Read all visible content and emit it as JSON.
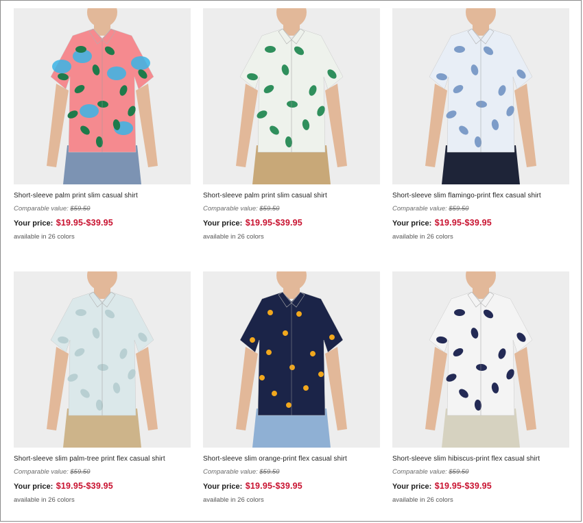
{
  "products": [
    {
      "name": "Short-sleeve palm print slim casual shirt",
      "comparable_label": "Comparable value:",
      "comparable_value": "$59.50",
      "price_label": "Your price:",
      "price": "$19.95-$39.95",
      "colors_text": "available in 26 colors",
      "shirt_color": "#f58a8f",
      "accent_color": "#39b4e6",
      "leaf_color": "#1f7a4a",
      "pants_color": "#7c93b3"
    },
    {
      "name": "Short-sleeve palm print slim casual shirt",
      "comparable_label": "Comparable value:",
      "comparable_value": "$59.50",
      "price_label": "Your price:",
      "price": "$19.95-$39.95",
      "colors_text": "available in 26 colors",
      "shirt_color": "#eef2ec",
      "accent_color": "#eef2ec",
      "leaf_color": "#2f8f5c",
      "pants_color": "#c8a878"
    },
    {
      "name": "Short-sleeve slim flamingo-print flex casual shirt",
      "comparable_label": "Comparable value:",
      "comparable_value": "$59.50",
      "price_label": "Your price:",
      "price": "$19.95-$39.95",
      "colors_text": "available in 26 colors",
      "shirt_color": "#e8eef6",
      "accent_color": "#e8eef6",
      "leaf_color": "#7d9cc8",
      "pants_color": "#1e2438"
    },
    {
      "name": "Short-sleeve slim palm-tree print flex casual shirt",
      "comparable_label": "Comparable value:",
      "comparable_value": "$59.50",
      "price_label": "Your price:",
      "price": "$19.95-$39.95",
      "colors_text": "available in 26 colors",
      "shirt_color": "#dbe8ea",
      "accent_color": "#dbe8ea",
      "leaf_color": "#b8cfd2",
      "pants_color": "#cdb48a"
    },
    {
      "name": "Short-sleeve slim orange-print flex casual shirt",
      "comparable_label": "Comparable value:",
      "comparable_value": "$59.50",
      "price_label": "Your price:",
      "price": "$19.95-$39.95",
      "colors_text": "available in 26 colors",
      "shirt_color": "#1b2448",
      "accent_color": "#1b2448",
      "leaf_color": "#f2a81d",
      "pants_color": "#8fb0d4"
    },
    {
      "name": "Short-sleeve slim hibiscus-print flex casual shirt",
      "comparable_label": "Comparable value:",
      "comparable_value": "$59.50",
      "price_label": "Your price:",
      "price": "$19.95-$39.95",
      "colors_text": "available in 26 colors",
      "shirt_color": "#f4f4f4",
      "accent_color": "#f4f4f4",
      "leaf_color": "#232a55",
      "pants_color": "#d6d2c0"
    }
  ]
}
